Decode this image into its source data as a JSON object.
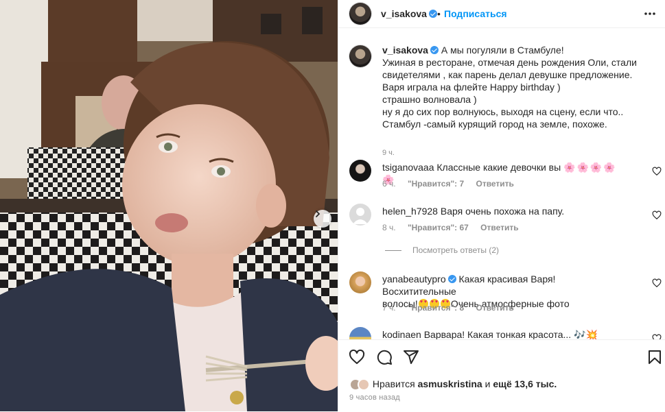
{
  "post": {
    "author": "v_isakova",
    "follow_label": "Подписаться",
    "separator": "•",
    "caption": "А мы погуляли в Стамбуле!\nУжиная в ресторане, отмечая день рождения Оли, стали свидетелями , как парень делал девушке предложение.\nВаря играла на флейте Happy birthday )\nстрашно волновала )\nну я до сих пор волнуюсь, выходя на сцену, если что..\nСтамбул -самый курящий город на земле, похоже.",
    "caption_time": "9 ч."
  },
  "comments": [
    {
      "username": "tsiganovaaa",
      "text": "Классные какие девочки вы",
      "emoji": "🌸🌸🌸🌸🌸",
      "time": "6 ч.",
      "likes": "\"Нравится\": 7",
      "reply": "Ответить"
    },
    {
      "username": "helen_h7928",
      "text": "Варя очень похожа на папу.",
      "time": "8 ч.",
      "likes": "\"Нравится\": 67",
      "reply": "Ответить",
      "view_replies": "Посмотреть ответы (2)"
    },
    {
      "username": "yanabeautypro",
      "text_1": "Какая красивая Варя!Восхитительные",
      "text_2a": "волосы!",
      "text_2b": "Очень атмосферные фото",
      "time": "7 ч.",
      "likes": "\"Нравится\": 8",
      "reply": "Ответить"
    },
    {
      "username": "kodinaen",
      "text": "Варвара! Какая тонкая красота...",
      "emoji": "🎶💥"
    }
  ],
  "footer": {
    "likes_prefix": "Нравится",
    "likes_user": "asmuskristina",
    "likes_and": "и",
    "likes_count": "ещё 13,6 тыс.",
    "time": "9 часов назад"
  },
  "icons": {
    "more": "more-options-icon",
    "like": "heart-icon",
    "comment": "comment-icon",
    "share": "share-icon",
    "save": "bookmark-icon",
    "next": "chevron-right-icon"
  },
  "colors": {
    "link": "#0095f6",
    "verified": "#3897f0",
    "muted": "#8e8e8e"
  }
}
